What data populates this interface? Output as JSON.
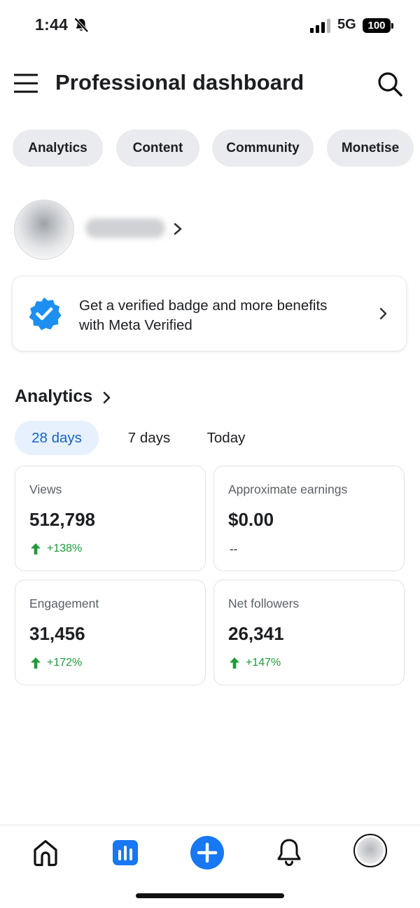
{
  "status_bar": {
    "time": "1:44",
    "network": "5G",
    "battery": "100"
  },
  "header": {
    "title": "Professional dashboard"
  },
  "tabs": [
    {
      "label": "Analytics"
    },
    {
      "label": "Content"
    },
    {
      "label": "Community"
    },
    {
      "label": "Monetise"
    }
  ],
  "verified_card": {
    "text_line1": "Get a verified badge and more benefits",
    "text_line2": "with Meta Verified"
  },
  "analytics": {
    "heading": "Analytics",
    "ranges": [
      {
        "label": "28 days",
        "active": true
      },
      {
        "label": "7 days",
        "active": false
      },
      {
        "label": "Today",
        "active": false
      }
    ],
    "cards": [
      {
        "label": "Views",
        "value": "512,798",
        "change": "+138%",
        "trend": "up"
      },
      {
        "label": "Approximate earnings",
        "value": "$0.00",
        "change": "--",
        "trend": "none"
      },
      {
        "label": "Engagement",
        "value": "31,456",
        "change": "+172%",
        "trend": "up"
      },
      {
        "label": "Net followers",
        "value": "26,341",
        "change": "+147%",
        "trend": "up"
      }
    ]
  },
  "bottom_nav": {
    "items": [
      "home-icon",
      "analytics-icon",
      "create-icon",
      "notifications-icon",
      "profile-avatar"
    ]
  },
  "colors": {
    "accent": "#1877f2",
    "positive": "#1f9a3a",
    "pill_bg": "#e9ebee",
    "active_range_bg": "#e7f0fd",
    "active_range_text": "#1565c0"
  }
}
